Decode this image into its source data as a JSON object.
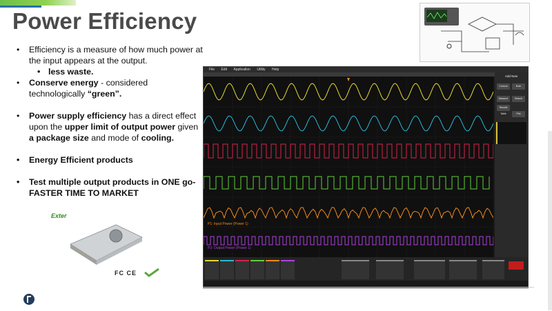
{
  "slide": {
    "title": "Power Efficiency",
    "bullets": [
      {
        "pre": "Efficiency is a measure of how much power at the input appears at the output.",
        "sub": "less waste."
      },
      {
        "b1": "Conserve energy",
        "t1": " - considered technologically ",
        "b2": "“green”."
      },
      {
        "b1": "Power supply efficiency",
        "t1": " has a direct effect upon the ",
        "b2": "upper limit of output power",
        "t2": " given ",
        "b3": "a package size",
        "t3": " and mode of ",
        "b4": "cooling."
      },
      {
        "b1": "Energy Efficient products"
      },
      {
        "b1": "Test multiple output products in ONE go-FASTER TIME TO MARKET"
      }
    ],
    "product_logo": "Exter",
    "certs": "FC CE"
  },
  "scope": {
    "menu": [
      "File",
      "Edit",
      "Application",
      "Utility",
      "Help"
    ],
    "right_panel": {
      "title": "Add New",
      "buttons": [
        "Cursors",
        "Note",
        "Measure",
        "Search",
        "Results Table",
        "Plot"
      ]
    },
    "overlay_labels": {
      "input": "P1: Input Power (Power 1)",
      "output": "P2: Output Power (Power 1)"
    },
    "colors": {
      "ch1": "#e6d830",
      "ch2": "#29b9d6",
      "ch3": "#d6244a",
      "ch4": "#5fd23a",
      "ch5": "#f08a1c",
      "ch6": "#b040e0"
    }
  }
}
